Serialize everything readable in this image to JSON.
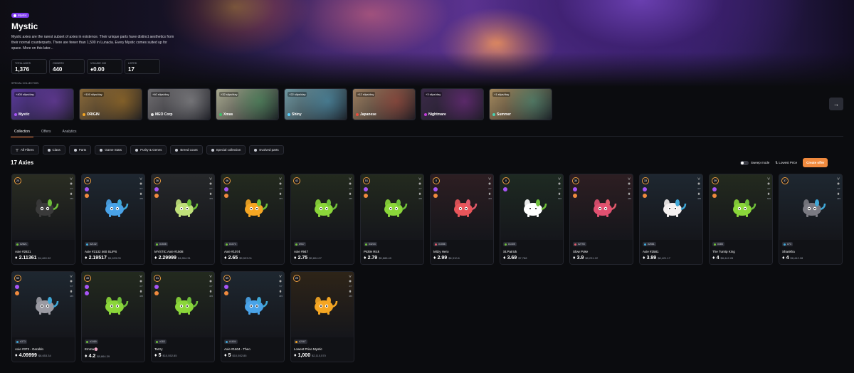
{
  "hero": {
    "badge": "Mystic",
    "title": "Mystic",
    "description": "Mystic axies are the rarest subset of axies in existence. Their unique parts have distinct aesthetics from their normal counterparts. There are fewer than 1,500 in Lunacia. Every Mystic comes suited up for space. More on this later..."
  },
  "stats": [
    {
      "label": "Total Axies",
      "value": "1,376"
    },
    {
      "label": "Owners",
      "value": "440"
    },
    {
      "label": "Volume 24H",
      "value": "♦0.00"
    },
    {
      "label": "Listed",
      "value": "17"
    }
  ],
  "special_label": "Special collection",
  "specials": [
    {
      "slips": "+400 slips/day",
      "name": "Mystic",
      "bg": "#5a3a9a",
      "dot": "#a855f7"
    },
    {
      "slips": "+100 slips/day",
      "name": "ORIGIN",
      "bg": "#8a6a3a",
      "dot": "#f5a623"
    },
    {
      "slips": "+40 slips/day",
      "name": "MEO Corp",
      "bg": "#6f6d70",
      "dot": "#e0e0e0"
    },
    {
      "slips": "+32 slips/day",
      "name": "Xmas",
      "bg": "#a7a88f",
      "dot": "#3fbf6a"
    },
    {
      "slips": "+22 slips/day",
      "name": "Shiny",
      "bg": "#6f97a0",
      "dot": "#5ad0ff"
    },
    {
      "slips": "+12 slips/day",
      "name": "Japanese",
      "bg": "#9c7e60",
      "dot": "#e74c3c"
    },
    {
      "slips": "+3 slips/day",
      "name": "Nightmare",
      "bg": "#3b2a48",
      "dot": "#c03ad8"
    },
    {
      "slips": "+1 slips/day",
      "name": "Summer",
      "bg": "#a58a5e",
      "dot": "#4ad0b0"
    }
  ],
  "next_arrow": "→",
  "tabs": [
    "Collection",
    "Offers",
    "Analytics"
  ],
  "filters": [
    "All Filters",
    "Class",
    "Parts",
    "Game Stats",
    "Purity & Genes",
    "Breed count",
    "Special collection",
    "Evolved parts"
  ],
  "count": "17 Axies",
  "controls": {
    "sweep": "Sweep mode",
    "sort": "Lowest Price",
    "offer": "Create offer"
  },
  "axies": [
    {
      "lvl": "20",
      "id": "#2821",
      "name": "Axie #2821",
      "eth": "2.11361",
      "usd": "$4,460.92",
      "bg": "#2a2d22",
      "body": "#3a3a3a",
      "cls": "#6fbf3a",
      "stat": "2/7",
      "breed": "465",
      "marks": []
    },
    {
      "lvl": "36",
      "id": "#2132",
      "name": "Axie #2132 460 SLIPS",
      "eth": "2.19517",
      "usd": "$4,633.05",
      "bg": "#1e2730",
      "body": "#4aa3e8",
      "cls": "#3fa8d8",
      "stat": "5/7",
      "breed": "465",
      "marks": [
        "#a855f7",
        "#f08a3e"
      ]
    },
    {
      "lvl": "36",
      "id": "#1508",
      "name": "MYSTIC Axie #1508",
      "eth": "2.29999",
      "usd": "$4,854.31",
      "bg": "#26282a",
      "body": "#bfe07a",
      "cls": "#6fbf3a",
      "stat": "0/7",
      "breed": "465",
      "marks": [
        "#a855f7",
        "#f08a3e"
      ]
    },
    {
      "lvl": "46",
      "id": "#1074",
      "name": "Axie #1074",
      "eth": "2.65",
      "usd": "$5,593.01",
      "bg": "#232a1e",
      "body": "#f5a623",
      "cls": "#6fbf3a",
      "stat": "2/7",
      "breed": "465",
      "marks": [
        "#a855f7",
        "#f08a3e"
      ]
    },
    {
      "lvl": "42",
      "id": "#947",
      "name": "Axie #947",
      "eth": "2.75",
      "usd": "$5,804.07",
      "bg": "#232a1e",
      "body": "#8bd63a",
      "cls": "#6fbf3a",
      "stat": "2/7",
      "breed": "465",
      "marks": []
    },
    {
      "lvl": "51",
      "id": "#3234",
      "name": "Pickle Rick",
      "eth": "2.79",
      "usd": "$5,888.49",
      "bg": "#232a1e",
      "body": "#8bd63a",
      "cls": "#6fbf3a",
      "stat": "2/7",
      "breed": "465",
      "marks": [
        "#a855f7",
        "#f08a3e"
      ]
    },
    {
      "lvl": "0",
      "id": "#1086",
      "name": "Mitzy Hero",
      "eth": "2.99",
      "usd": "$6,310.6",
      "bg": "#2d1e22",
      "body": "#e8555a",
      "cls": "#e05a6a",
      "stat": "0/7",
      "breed": "465",
      "marks": [
        "#a855f7",
        "#f08a3e"
      ]
    },
    {
      "lvl": "0",
      "id": "#1405",
      "name": "St.Patrick",
      "eth": "3.69",
      "usd": "$7,788",
      "bg": "#1e2a22",
      "body": "#ffffff",
      "cls": "#6fbf3a",
      "stat": "3/7",
      "breed": "530",
      "marks": [
        "#a855f7"
      ]
    },
    {
      "lvl": "30",
      "id": "#2793",
      "name": "Slow Poke",
      "eth": "3.9",
      "usd": "$8,231.22",
      "bg": "#2d1e22",
      "body": "#e05070",
      "cls": "#e05a6a",
      "stat": "2/7",
      "breed": "465",
      "marks": [
        "#a855f7",
        "#f08a3e"
      ]
    },
    {
      "lvl": "33",
      "id": "#2581",
      "name": "Axie #2581",
      "eth": "3.99",
      "usd": "$8,421.17",
      "bg": "#1e2730",
      "body": "#f4f0f0",
      "cls": "#3fa8d8",
      "stat": "0/7",
      "breed": "465",
      "marks": [
        "#a855f7",
        "#f08a3e"
      ]
    },
    {
      "lvl": "39",
      "id": "#485",
      "name": "The Turnip King",
      "eth": "4",
      "usd": "$8,442.28",
      "bg": "#232a1e",
      "body": "#8bd63a",
      "cls": "#6fbf3a",
      "stat": "0/7",
      "breed": "530",
      "marks": [
        "#a855f7",
        "#f08a3e"
      ]
    },
    {
      "lvl": "37",
      "id": "#73",
      "name": "Shankha",
      "eth": "4",
      "usd": "$8,442.28",
      "bg": "#1e2730",
      "body": "#7a7a82",
      "cls": "#3fa8d8",
      "stat": "2/7",
      "breed": "465",
      "marks": []
    },
    {
      "lvl": "59",
      "id": "#373",
      "name": "Axie #373 - Geraldo",
      "eth": "4.09999",
      "usd": "$8,653.34",
      "bg": "#1e2730",
      "body": "#9a9aa2",
      "cls": "#3fa8d8",
      "stat": "5/7",
      "breed": "465",
      "marks": [
        "#a855f7",
        "#f08a3e"
      ]
    },
    {
      "lvl": "49",
      "id": "#1989",
      "name": "Emma🌸",
      "eth": "4.2",
      "usd": "$8,864.39",
      "bg": "#232a1e",
      "body": "#8bd63a",
      "cls": "#6fbf3a",
      "stat": "0/7",
      "breed": "465",
      "marks": [
        "#a855f7",
        "#a855f7"
      ]
    },
    {
      "lvl": "31",
      "id": "#383",
      "name": "Tazzy",
      "eth": "5",
      "usd": "$10,552.85",
      "bg": "#232a1e",
      "body": "#8bd63a",
      "cls": "#6fbf3a",
      "stat": "0/7",
      "breed": "465",
      "marks": [
        "#a855f7",
        "#f08a3e"
      ]
    },
    {
      "lvl": "59",
      "id": "#1604",
      "name": "Axie #1604 - Theo",
      "eth": "5",
      "usd": "$10,552.85",
      "bg": "#1e2730",
      "body": "#4aa3e8",
      "cls": "#3fa8d8",
      "stat": "5/7",
      "breed": "465",
      "marks": [
        "#a855f7",
        "#f08a3e"
      ]
    },
    {
      "lvl": "29",
      "id": "#2067",
      "name": "Lowest Price Mystic",
      "eth": "1,000",
      "usd": "$2,110,570",
      "bg": "#2e2418",
      "body": "#f5a623",
      "cls": "#f5a623",
      "stat": "2/7",
      "breed": "465",
      "marks": []
    }
  ]
}
